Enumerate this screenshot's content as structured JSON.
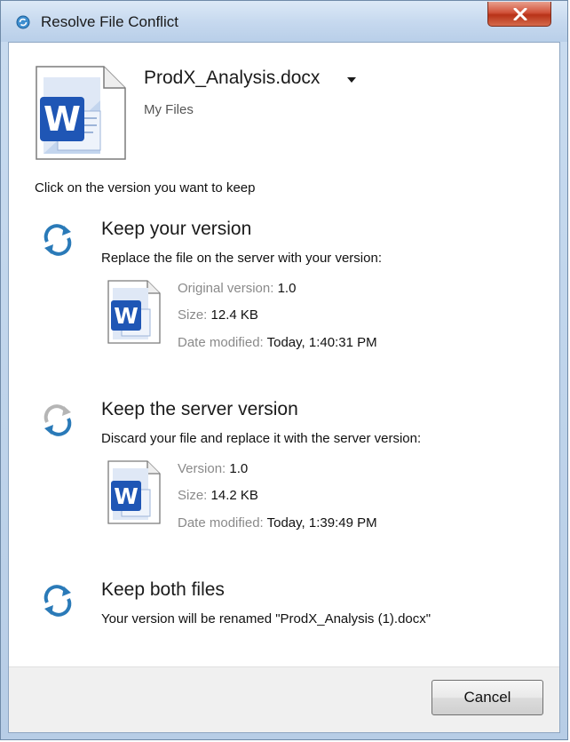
{
  "window": {
    "title": "Resolve File Conflict"
  },
  "header": {
    "file_name": "ProdX_Analysis.docx",
    "location": "My Files"
  },
  "instruction": "Click on the version you want to keep",
  "options": [
    {
      "title": "Keep your version",
      "description": "Replace the file on the server with your version:",
      "details": [
        {
          "label": "Original version:",
          "value": "1.0"
        },
        {
          "label": "Size:",
          "value": "12.4 KB"
        },
        {
          "label": "Date modified:",
          "value": "Today, 1:40:31 PM"
        }
      ]
    },
    {
      "title": "Keep the server version",
      "description": "Discard your file and replace it with the server version:",
      "details": [
        {
          "label": "Version:",
          "value": "1.0"
        },
        {
          "label": "Size:",
          "value": "14.2 KB"
        },
        {
          "label": "Date modified:",
          "value": "Today, 1:39:49 PM"
        }
      ]
    },
    {
      "title": "Keep both files",
      "description": "Your version will be renamed \"ProdX_Analysis (1).docx\""
    }
  ],
  "footer": {
    "cancel_label": "Cancel"
  },
  "icons": {
    "app": "sync-app-icon",
    "close": "close-icon",
    "dropdown": "chevron-down-icon",
    "document": "word-document-icon",
    "sync": "sync-arrows-icon"
  },
  "colors": {
    "sync_blue": "#2a7ab8",
    "sync_gray": "#b5b5b5",
    "word_blue": "#1d4fa8",
    "close_red": "#c94a30"
  }
}
